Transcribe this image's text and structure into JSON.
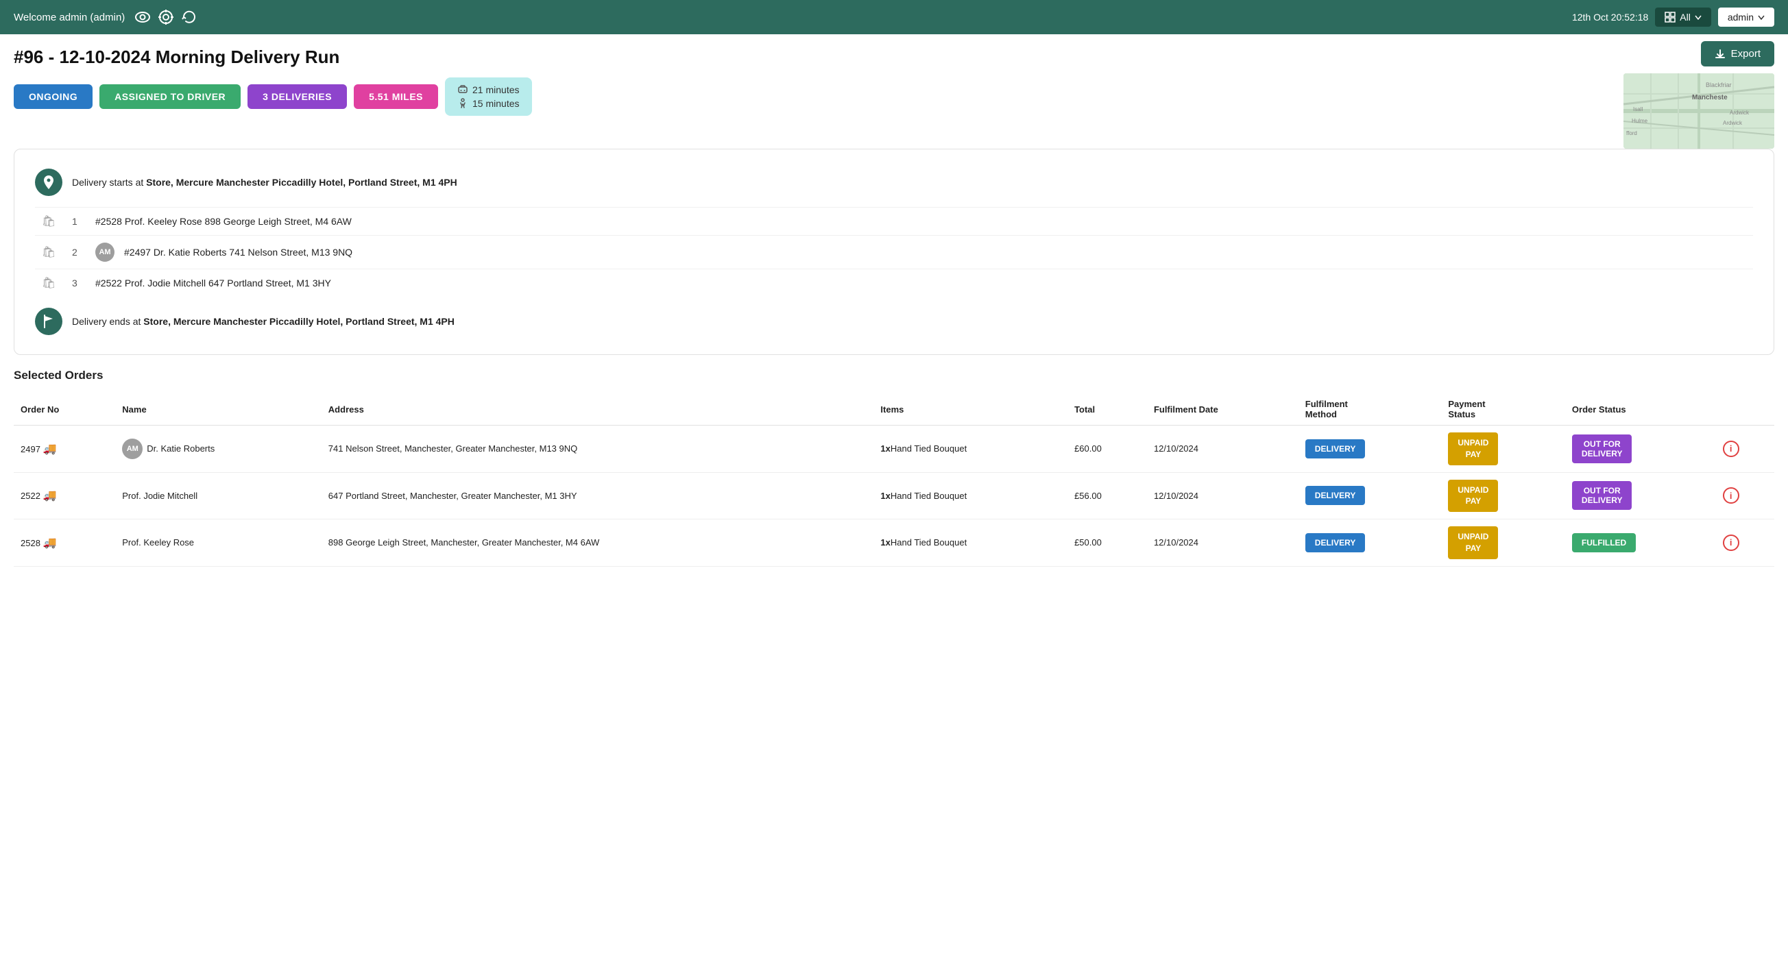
{
  "header": {
    "welcome": "Welcome admin (admin)",
    "datetime": "12th Oct 20:52:18",
    "all_label": "All",
    "admin_label": "admin"
  },
  "page": {
    "title": "#96 - 12-10-2024 Morning Delivery Run",
    "export_label": "Export"
  },
  "badges": {
    "ongoing": "ONGOING",
    "assigned_driver": "ASSIGNED TO DRIVER",
    "deliveries": "3 DELIVERIES",
    "miles": "5.51 MILES",
    "time_drive": "21 minutes",
    "time_walk": "15 minutes"
  },
  "route": {
    "start_label": "Delivery starts at",
    "start_location": "Store, Mercure Manchester Piccadilly Hotel, Portland Street, M1 4PH",
    "end_label": "Delivery ends at",
    "end_location": "Store, Mercure Manchester Piccadilly Hotel, Portland Street, M1 4PH",
    "deliveries": [
      {
        "num": "1",
        "text": "#2528 Prof. Keeley Rose 898 George Leigh Street, M4 6AW",
        "has_avatar": false,
        "avatar": ""
      },
      {
        "num": "2",
        "text": "#2497 Dr. Katie Roberts 741 Nelson Street, M13 9NQ",
        "has_avatar": true,
        "avatar": "AM"
      },
      {
        "num": "3",
        "text": "#2522 Prof. Jodie Mitchell 647 Portland Street, M1 3HY",
        "has_avatar": false,
        "avatar": ""
      }
    ]
  },
  "orders": {
    "section_title": "Selected Orders",
    "columns": [
      "Order No",
      "Name",
      "Address",
      "Items",
      "Total",
      "Fulfilment Date",
      "Fulfilment Method",
      "Payment Status",
      "Order Status"
    ],
    "rows": [
      {
        "order_no": "2497",
        "name": "Dr. Katie Roberts",
        "avatar": "AM",
        "address": "741 Nelson Street, Manchester, Greater Manchester, M13 9NQ",
        "items": "1x Hand Tied Bouquet",
        "total": "£60.00",
        "fulfilment_date": "12/10/2024",
        "method": "DELIVERY",
        "payment_status": "UNPAID\nPAY",
        "order_status": "OUT FOR DELIVERY",
        "order_status_color": "purple"
      },
      {
        "order_no": "2522",
        "name": "Prof. Jodie Mitchell",
        "avatar": "",
        "address": "647 Portland Street, Manchester, Greater Manchester, M1 3HY",
        "items": "1x Hand Tied Bouquet",
        "total": "£56.00",
        "fulfilment_date": "12/10/2024",
        "method": "DELIVERY",
        "payment_status": "UNPAID\nPAY",
        "order_status": "OUT FOR DELIVERY",
        "order_status_color": "purple"
      },
      {
        "order_no": "2528",
        "name": "Prof. Keeley Rose",
        "avatar": "",
        "address": "898 George Leigh Street, Manchester, Greater Manchester, M4 6AW",
        "items": "1x Hand Tied Bouquet",
        "total": "£50.00",
        "fulfilment_date": "12/10/2024",
        "method": "DELIVERY",
        "payment_status": "UNPAID\nPAY",
        "order_status": "FULFILLED",
        "order_status_color": "green"
      }
    ]
  }
}
